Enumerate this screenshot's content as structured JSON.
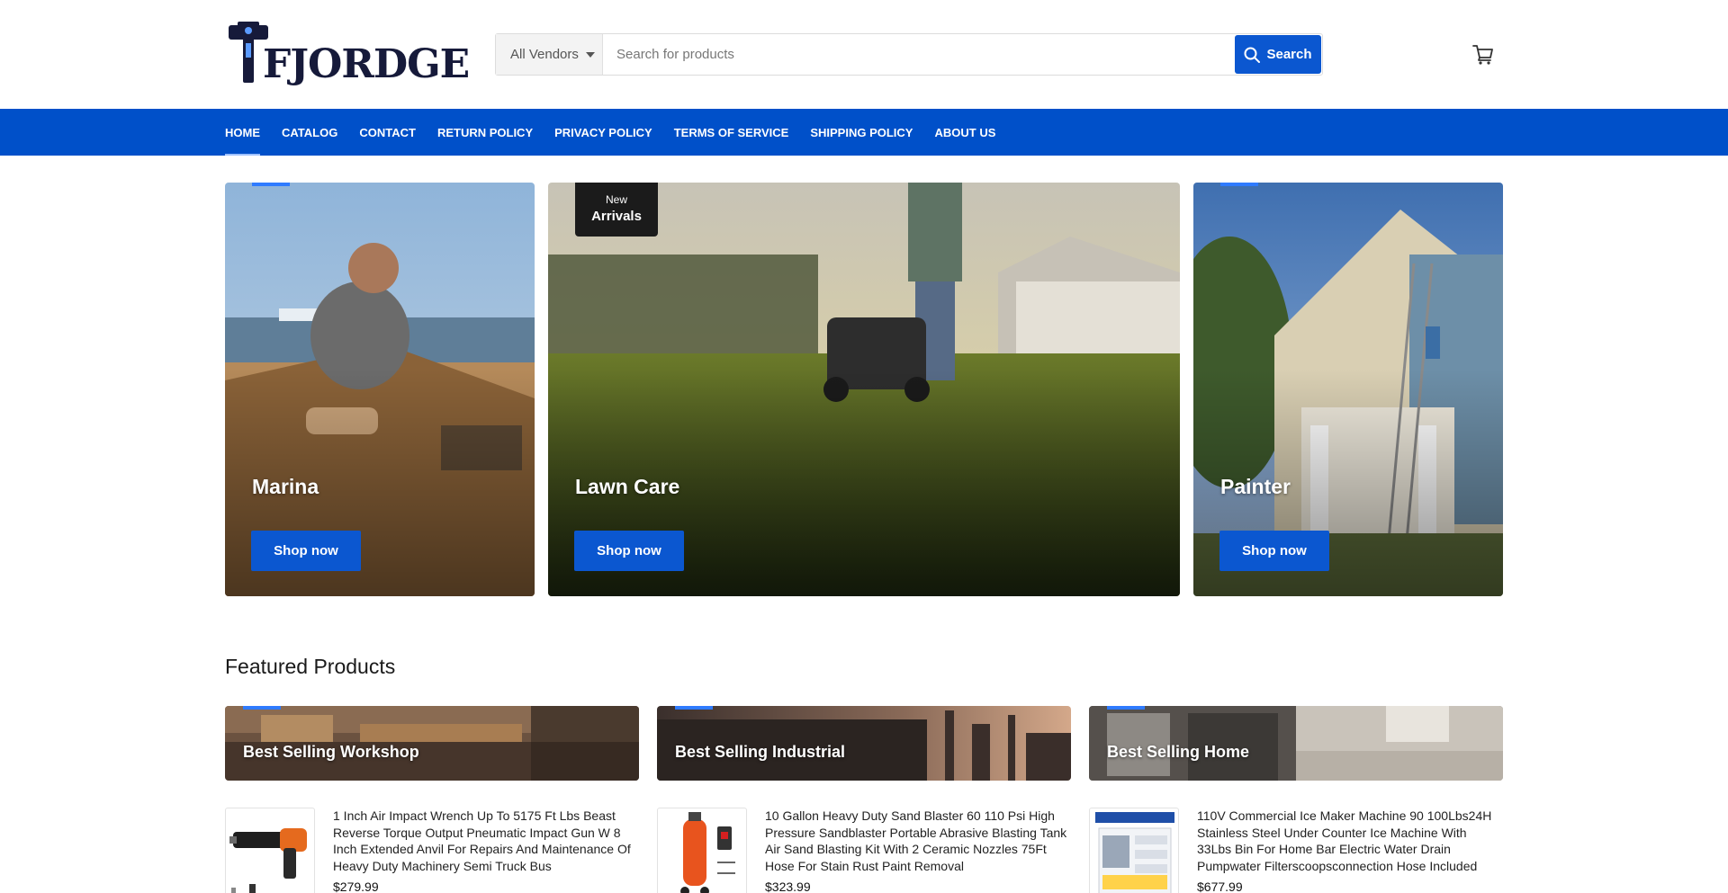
{
  "header": {
    "logo_text": "FJORDGE",
    "vendor_select": "All Vendors",
    "search_placeholder": "Search for products",
    "search_button": "Search"
  },
  "nav": {
    "items": [
      "HOME",
      "CATALOG",
      "CONTACT",
      "RETURN POLICY",
      "PRIVACY POLICY",
      "TERMS OF SERVICE",
      "SHIPPING POLICY",
      "ABOUT US"
    ],
    "active": "HOME"
  },
  "hero": [
    {
      "title": "Marina",
      "button": "Shop now"
    },
    {
      "title": "Lawn Care",
      "button": "Shop now",
      "badge_line1": "New",
      "badge_line2": "Arrivals"
    },
    {
      "title": "Painter",
      "button": "Shop now"
    }
  ],
  "featured": {
    "title": "Featured Products",
    "categories": [
      {
        "label": "Best Selling Workshop"
      },
      {
        "label": "Best Selling Industrial"
      },
      {
        "label": "Best Selling Home"
      }
    ],
    "products": [
      {
        "title": "1 Inch Air Impact Wrench Up To 5175 Ft Lbs Beast Reverse Torque Output Pneumatic Impact Gun W 8 Inch Extended Anvil For Repairs And Maintenance Of Heavy Duty Machinery Semi Truck Bus",
        "price": "$279.99"
      },
      {
        "title": "10 Gallon Heavy Duty Sand Blaster 60 110 Psi High Pressure Sandblaster Portable Abrasive Blasting Tank Air Sand Blasting Kit With 2 Ceramic Nozzles 75Ft Hose For Stain Rust Paint Removal",
        "price": "$323.99"
      },
      {
        "title": "110V Commercial Ice Maker Machine 90 100Lbs24H Stainless Steel Under Counter Ice Machine With 33Lbs Bin For Home Bar Electric Water Drain Pumpwater Filterscoopsconnection Hose Included",
        "price": "$677.99"
      }
    ]
  },
  "colors": {
    "primary": "#0b57d0",
    "nav_bg": "#0050c9",
    "accent": "#2f7bff"
  }
}
